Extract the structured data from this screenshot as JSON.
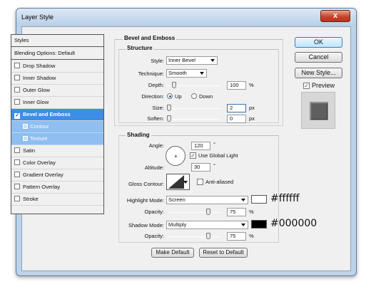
{
  "window": {
    "title": "Layer Style",
    "close_label": "x"
  },
  "styles_panel": {
    "header": "Styles",
    "blending": "Blending Options: Default",
    "items": [
      {
        "label": "Drop Shadow",
        "checked": false
      },
      {
        "label": "Inner Shadow",
        "checked": false
      },
      {
        "label": "Outer Glow",
        "checked": false
      },
      {
        "label": "Inner Glow",
        "checked": false
      },
      {
        "label": "Bevel and Emboss",
        "checked": true,
        "selected": true
      },
      {
        "label": "Contour",
        "sub": true
      },
      {
        "label": "Texture",
        "sub": true
      },
      {
        "label": "Satin",
        "checked": false
      },
      {
        "label": "Color Overlay",
        "checked": false
      },
      {
        "label": "Gradient Overlay",
        "checked": false
      },
      {
        "label": "Pattern Overlay",
        "checked": false
      },
      {
        "label": "Stroke",
        "checked": false
      }
    ]
  },
  "bevel": {
    "section_title": "Bevel and Emboss",
    "structure_title": "Structure",
    "style_label": "Style:",
    "style_value": "Inner Bevel",
    "technique_label": "Technique:",
    "technique_value": "Smooth",
    "depth_label": "Depth:",
    "depth_value": "100",
    "depth_unit": "%",
    "depth_level": 0.1,
    "direction_label": "Direction:",
    "direction_up": "Up",
    "direction_down": "Down",
    "direction_selected": "Up",
    "size_label": "Size:",
    "size_value": "2",
    "size_unit": "px",
    "soften_label": "Soften:",
    "soften_value": "0",
    "soften_unit": "px"
  },
  "shading": {
    "title": "Shading",
    "angle_label": "Angle:",
    "angle_value": "120",
    "angle_unit": "°",
    "global_light_label": "Use Global Light",
    "global_light_checked": true,
    "altitude_label": "Altitude:",
    "altitude_value": "30",
    "altitude_unit": "°",
    "gloss_label": "Gloss Contour:",
    "anti_aliased_label": "Anti-aliased",
    "highlight_mode_label": "Highlight Mode:",
    "highlight_mode_value": "Screen",
    "highlight_color": "#ffffff",
    "highlight_hex_text": "#ffffff",
    "opacity_label": "Opacity:",
    "highlight_opacity": "75",
    "opacity_unit": "%",
    "shadow_mode_label": "Shadow Mode:",
    "shadow_mode_value": "Multiply",
    "shadow_color": "#000000",
    "shadow_hex_text": "#000000",
    "shadow_opacity": "75"
  },
  "footer": {
    "make_default": "Make Default",
    "reset_default": "Reset to Default"
  },
  "side": {
    "ok": "OK",
    "cancel": "Cancel",
    "new_style": "New Style...",
    "preview": "Preview",
    "preview_checked": true
  }
}
